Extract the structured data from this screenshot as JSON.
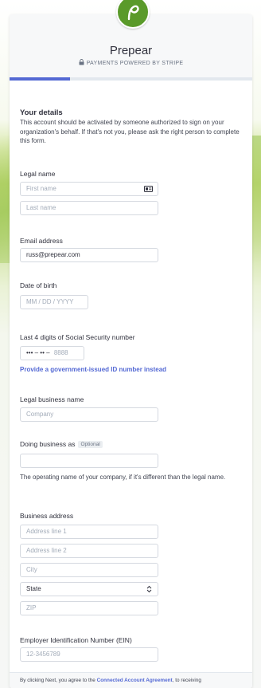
{
  "header": {
    "brand_name": "Prepear",
    "powered_by": "PAYMENTS POWERED BY STRIPE"
  },
  "progress_fraction": 0.25,
  "section": {
    "title": "Your details",
    "description": "This account should be activated by someone authorized to sign on your organization's behalf. If that's not you, please ask the right person to complete this form."
  },
  "legal_name": {
    "label": "Legal name",
    "first_placeholder": "First name",
    "last_placeholder": "Last name"
  },
  "email": {
    "label": "Email address",
    "value": "russ@prepear.com"
  },
  "dob": {
    "label": "Date of birth",
    "placeholder": "MM / DD / YYYY"
  },
  "ssn": {
    "label": "Last 4 digits of Social Security number",
    "masked_prefix": "••• – •• –",
    "placeholder": "8888",
    "alt_link": "Provide a government-issued ID number instead"
  },
  "business_name": {
    "label": "Legal business name",
    "placeholder": "Company"
  },
  "dba": {
    "label": "Doing business as",
    "optional_badge": "Optional",
    "value": "",
    "help": "The operating name of your company, if it's different than the legal name."
  },
  "address": {
    "label": "Business address",
    "line1_placeholder": "Address line 1",
    "line2_placeholder": "Address line 2",
    "city_placeholder": "City",
    "state_selected": "State",
    "zip_placeholder": "ZIP"
  },
  "ein": {
    "label": "Employer Identification Number (EIN)",
    "placeholder": "12-3456789"
  },
  "footer": {
    "prefix": "By clicking Next, you agree to the ",
    "link": "Connected Account Agreement",
    "suffix": ", to receiving"
  },
  "colors": {
    "accent": "#5469d4",
    "brand_green": "#5a9a2a"
  }
}
